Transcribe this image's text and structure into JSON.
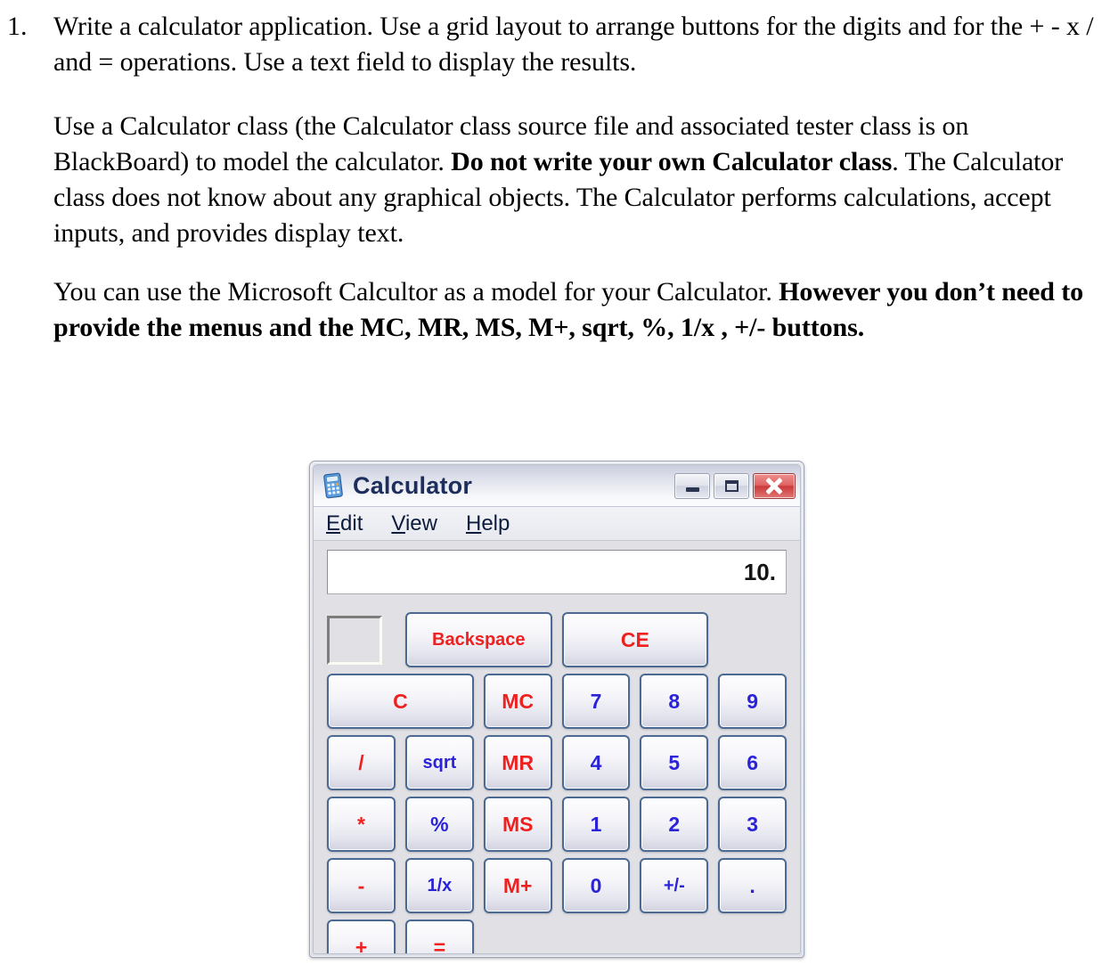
{
  "document": {
    "list_number": "1.",
    "paragraphs": [
      {
        "id": "p1",
        "runs": [
          {
            "text": "Write a calculator application.  Use a grid layout to arrange buttons for the digits and for the + - x / and = operations.  Use a text field to display the results.",
            "bold": false
          }
        ]
      },
      {
        "id": "p2",
        "runs": [
          {
            "text": "Use a Calculator class  (the Calculator class source file and associated tester class is on BlackBoard) to model the calculator.  ",
            "bold": false
          },
          {
            "text": "Do not write your own Calculator class",
            "bold": true
          },
          {
            "text": ".  The Calculator class does not know about any graphical objects.  The Calculator performs calculations, accept inputs, and provides display text.",
            "bold": false
          }
        ]
      },
      {
        "id": "p3",
        "runs": [
          {
            "text": "You can use the Microsoft Calcultor as a model for your Calculator.  ",
            "bold": false
          },
          {
            "text": "However you don’t need to provide the menus and the MC, MR, MS, M+, sqrt, %, 1/x , +/- buttons.",
            "bold": true
          }
        ]
      }
    ]
  },
  "calculator": {
    "window_title": "Calculator",
    "window_icon": "calculator-icon",
    "window_controls": [
      {
        "name": "minimize",
        "glyph": "dash"
      },
      {
        "name": "maximize",
        "glyph": "square"
      },
      {
        "name": "close",
        "glyph": "x"
      }
    ],
    "menu": [
      {
        "label": "Edit",
        "mnemonic": "E"
      },
      {
        "label": "View",
        "mnemonic": "V"
      },
      {
        "label": "Help",
        "mnemonic": "H"
      }
    ],
    "display_value": "10.",
    "memory_indicator": "",
    "top_row": [
      {
        "label": "Backspace",
        "color": "red"
      },
      {
        "label": "CE",
        "color": "red"
      },
      {
        "label": "C",
        "color": "red"
      }
    ],
    "keys": [
      {
        "label": "MC",
        "color": "red"
      },
      {
        "label": "7",
        "color": "blue"
      },
      {
        "label": "8",
        "color": "blue"
      },
      {
        "label": "9",
        "color": "blue"
      },
      {
        "label": "/",
        "color": "red"
      },
      {
        "label": "sqrt",
        "color": "blue"
      },
      {
        "label": "MR",
        "color": "red"
      },
      {
        "label": "4",
        "color": "blue"
      },
      {
        "label": "5",
        "color": "blue"
      },
      {
        "label": "6",
        "color": "blue"
      },
      {
        "label": "*",
        "color": "red"
      },
      {
        "label": "%",
        "color": "blue"
      },
      {
        "label": "MS",
        "color": "red"
      },
      {
        "label": "1",
        "color": "blue"
      },
      {
        "label": "2",
        "color": "blue"
      },
      {
        "label": "3",
        "color": "blue"
      },
      {
        "label": "-",
        "color": "red"
      },
      {
        "label": "1/x",
        "color": "blue"
      },
      {
        "label": "M+",
        "color": "red"
      },
      {
        "label": "0",
        "color": "blue"
      },
      {
        "label": "+/-",
        "color": "blue"
      },
      {
        "label": ".",
        "color": "blue"
      },
      {
        "label": "+",
        "color": "red"
      },
      {
        "label": "=",
        "color": "red"
      }
    ],
    "colors": {
      "red": "#ee2020",
      "blue": "#2a23d8",
      "panel": "#e0e0e5",
      "button_border": "#4b6a93",
      "title_text": "#1d2e5c",
      "close_button": "#cc3a3a"
    }
  }
}
